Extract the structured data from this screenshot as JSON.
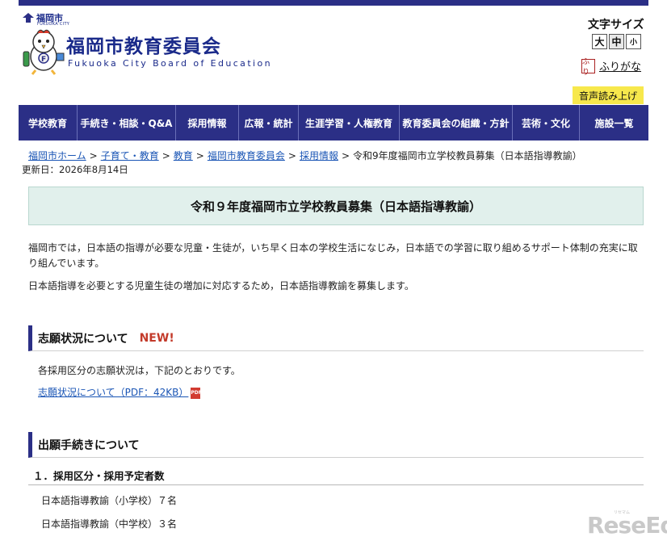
{
  "header": {
    "city_mark": "福岡市",
    "city_sub": "FUKUOKA CITY",
    "org_title": "福岡市教育委員会",
    "org_subtitle": "Fukuoka City Board of Education",
    "fontsize_label": "文字サイズ",
    "fontsize_buttons": [
      "大",
      "中",
      "小"
    ],
    "furigana_label": "ふりがな",
    "furigana_icon_text": "ふり",
    "tts_label": "音声読み上げ"
  },
  "nav": {
    "items": [
      "学校教育",
      "手続き・相談・Q&A",
      "採用情報",
      "広報・統計",
      "生涯学習・人権教育",
      "教育委員会の組織・方針",
      "芸術・文化",
      "施設一覧"
    ]
  },
  "breadcrumb": {
    "links": [
      "福岡市ホーム",
      "子育て・教育",
      "教育",
      "福岡市教育委員会",
      "採用情報"
    ],
    "current": "令和9年度福岡市立学校教員募集（日本語指導教諭）",
    "separator": ">"
  },
  "updated": "更新日：2026年8月14日",
  "page_title": "令和９年度福岡市立学校教員募集（日本語指導教諭）",
  "intro": {
    "p1": "福岡市では，日本語の指導が必要な児童・生徒が，いち早く日本の学校生活になじみ，日本語での学習に取り組めるサポート体制の充実に取り組んでいます。",
    "p2": "日本語指導を必要とする児童生徒の増加に対応するため，日本語指導教諭を募集します。"
  },
  "section_status": {
    "heading": "志願状況について",
    "badge": "NEW!",
    "text": "各採用区分の志願状況は，下記のとおりです。",
    "link": "志願状況について（PDF：42KB）",
    "pdf_icon_text": "PDF"
  },
  "section_apply": {
    "heading": "出願手続きについて",
    "subheading": "１．採用区分・採用予定者数",
    "rows": [
      "日本語指導教諭（小学校）７名",
      "日本語指導教諭（中学校）３名"
    ]
  },
  "watermark": {
    "text": "ReseEd",
    "sub": "リセマム"
  },
  "colors": {
    "navy": "#2b2f86",
    "link": "#1a55b5",
    "new": "#c33a2a",
    "title_bg": "#e1f0ec",
    "tts_bg": "#f7e84c"
  }
}
